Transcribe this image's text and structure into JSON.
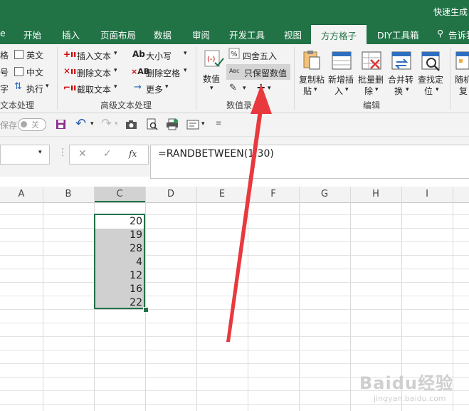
{
  "window": {
    "title": "快速生成"
  },
  "tabs": [
    {
      "label": "开始"
    },
    {
      "label": "插入"
    },
    {
      "label": "页面布局"
    },
    {
      "label": "数据"
    },
    {
      "label": "审阅"
    },
    {
      "label": "开发工具"
    },
    {
      "label": "视图"
    },
    {
      "label": "方方格子"
    },
    {
      "label": "DIY工具箱"
    },
    {
      "label": "告诉我"
    }
  ],
  "active_tab": "方方格子",
  "ribbon": {
    "text_group": {
      "items": [
        "格",
        "号",
        "字",
        "英文",
        "中文",
        "执行",
        "文本处理"
      ],
      "title": "文本处理"
    },
    "advanced_text_group": {
      "insert_text": "插入文本",
      "delete_text": "删除文本",
      "extract_text": "截取文本",
      "case": "大小写",
      "delete_space": "删除空格",
      "more": "更多",
      "title": "高级文本处理"
    },
    "number_entry_group": {
      "numeric": "数值",
      "round": "四舍五入",
      "keep_values": "只保留数值",
      "title": "数值录入"
    },
    "edit_group": {
      "copy_paste": [
        "复制粘",
        "贴"
      ],
      "insert_new": [
        "新增插",
        "入"
      ],
      "batch_delete": [
        "批量删",
        "除"
      ],
      "merge_convert": [
        "合并转",
        "换"
      ],
      "find_locate": [
        "查找定",
        "位"
      ],
      "random": [
        "随机",
        "复"
      ],
      "title": "编辑"
    }
  },
  "qat": {
    "save_label": "保存",
    "toggle_label": "关"
  },
  "formula_bar": {
    "formula": "=RANDBETWEEN(1,30)",
    "fx": "fx"
  },
  "columns": [
    "A",
    "B",
    "C",
    "D",
    "E",
    "F",
    "G",
    "H",
    "I"
  ],
  "cells_C": [
    "20",
    "19",
    "28",
    "4",
    "12",
    "16",
    "22"
  ],
  "watermark": {
    "brand": "Baidu经验",
    "url": "jingyan.baidu.com"
  },
  "colors": {
    "brand_green": "#217346",
    "arrow_red": "#e8393e",
    "selection_gray": "#d0d0d0"
  }
}
